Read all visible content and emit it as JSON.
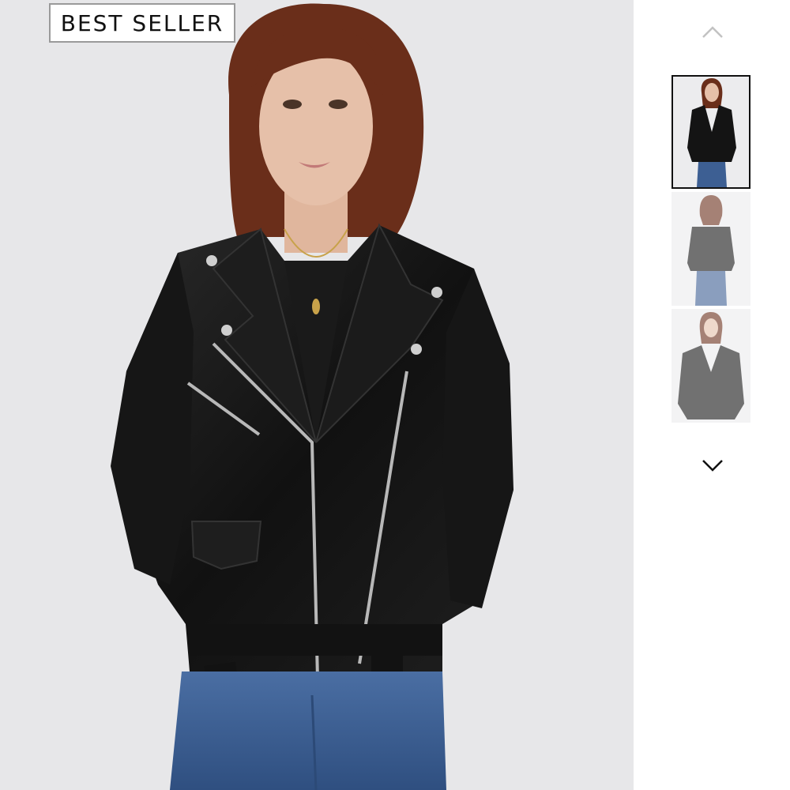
{
  "badge": {
    "label": "BEST SELLER"
  },
  "gallery": {
    "thumbnails": [
      {
        "view": "front-open",
        "selected": true
      },
      {
        "view": "back",
        "selected": false
      },
      {
        "view": "front-closed",
        "selected": false
      }
    ],
    "up_icon": "chevron-up-icon",
    "down_icon": "chevron-down-icon"
  },
  "colors": {
    "background": "#e7e7e9",
    "jacket": "#141414",
    "jeans": "#3d5f93",
    "hair": "#6a2e1a",
    "skin": "#e6c0a9",
    "selected_border": "#111111"
  }
}
